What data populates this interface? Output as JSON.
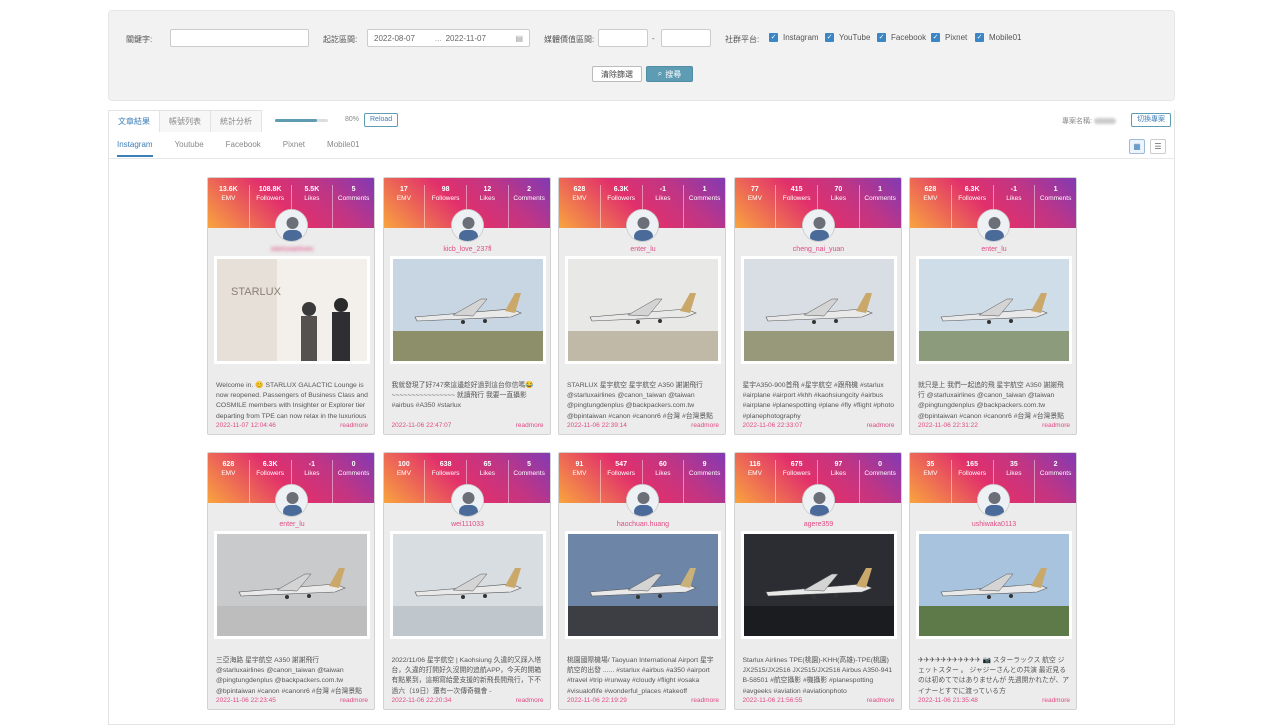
{
  "search": {
    "keyword_label": "關鍵字:",
    "date_label": "起訖區間:",
    "date_from": "2022-08-07",
    "date_sep": "...",
    "date_to": "2022-11-07",
    "value_label": "媒體價值區間:",
    "value_sep": "-",
    "platform_label": "社群平台:",
    "platforms": [
      "Instagram",
      "YouTube",
      "Facebook",
      "Pixnet",
      "Mobile01"
    ],
    "clear_label": "清除篩選",
    "search_label": "搜尋"
  },
  "tabs": [
    "文章結果",
    "帳號列表",
    "統計分析"
  ],
  "progress": {
    "value": 0.8,
    "label": "80%"
  },
  "reload_label": "Reload",
  "project_label": "專案名稱:",
  "switch_label": "切換專案",
  "subtabs": [
    "Instagram",
    "Youtube",
    "Facebook",
    "Pixnet",
    "Mobile01"
  ],
  "stat_labels": [
    "EMV",
    "Followers",
    "Likes",
    "Comments"
  ],
  "readmore": "readmore",
  "cards": [
    {
      "emv": "13.6K",
      "followers": "108.8K",
      "likes": "5.5K",
      "comments": "5",
      "user": "starluxairlines",
      "text": "Welcome in. 😊 STARLUX GALACTIC Lounge is now reopened. Passengers of Business Class and COSMILE members with Insighter or Explorer tier departing from TPE can now relax in the luxurious",
      "date": "2022-11-07 12:04:46"
    },
    {
      "emv": "17",
      "followers": "98",
      "likes": "12",
      "comments": "2",
      "user": "kicb_love_237fl",
      "text": "我就發現了好747來這邊趁好過到這台你信嗎😂 ~~~~~~~~~~~~~~~~ 就讀飛行 我要一直攝影 #airbus #A350 #starlux",
      "date": "2022-11-06 22:47:07"
    },
    {
      "emv": "628",
      "followers": "6.3K",
      "likes": "-1",
      "comments": "1",
      "user": "enter_lu",
      "text": "STARLUX 星宇航空 星宇航空 A350 謝謝飛行 @starluxairlines @canon_taiwan @taiwan @pingtungdenplus @backpackers.com.tw @bpintaiwan #canon #canonr6 #台灣 #台灣景點",
      "date": "2022-11-06 22:39:14"
    },
    {
      "emv": "77",
      "followers": "415",
      "likes": "70",
      "comments": "1",
      "user": "cheng_nai_yuan",
      "text": "星宇A350-900首飛 #星宇航空 #跟飛機 #starlux #airplane #airport #khh #kaohsiungcity #airbus #airplane #planespotting #plane #fly #flight #photo #planephotography",
      "date": "2022-11-06 22:33:07"
    },
    {
      "emv": "628",
      "followers": "6.3K",
      "likes": "-1",
      "comments": "1",
      "user": "enter_lu",
      "text": "就只是上 我們一起追的飛 星宇航空 A350 謝謝飛行 @starluxairlines @canon_taiwan @taiwan @pingtungdenplus @backpackers.com.tw @bpintaiwan #canon #canonr6 #台灣 #台灣景點",
      "date": "2022-11-06 22:31:22"
    },
    {
      "emv": "628",
      "followers": "6.3K",
      "likes": "-1",
      "comments": "0",
      "user": "enter_lu",
      "text": "三亞海路 星宇航空 A350 謝謝飛行 @starluxairlines @canon_taiwan @taiwan @pingtungdenplus @backpackers.com.tw @bpintaiwan #canon #canonr6 #台灣 #台灣景點",
      "date": "2022-11-06 22:23:45"
    },
    {
      "emv": "100",
      "followers": "638",
      "likes": "65",
      "comments": "5",
      "user": "wei111033",
      "text": "2022/11/06 星宇航空 | Kaohsiung 久違的又踩入塔台，久違的打開好久沒開的追航APP，今天的開箱有點累到，這期寫給愛支援的新飛長開飛行，下不過六（19日）還有一次傳奇機會 -",
      "date": "2022-11-06 22:20:34"
    },
    {
      "emv": "91",
      "followers": "547",
      "likes": "60",
      "comments": "9",
      "user": "haochuan.huang",
      "text": "桃園國際機場/ Taoyuan International Airport 星宇航空的出發 ...... #starlux #airbus #a350 #airport #travel #trip #runway #cloudy #flight #osaka #visualoflife #wonderful_places #takeoff",
      "date": "2022-11-06 22:19:29"
    },
    {
      "emv": "116",
      "followers": "675",
      "likes": "97",
      "comments": "0",
      "user": "agere359",
      "text": "Starlux Airlines TPE(桃園)-KHH(高雄)-TPE(桃園) JX2515/JX2516 JX2515/JX2516 Airbus A350-941 B-58501 #航空攝影 #機攝影 #planespotting #avgeeks #aviation #aviationphoto",
      "date": "2022-11-06 21:56:55"
    },
    {
      "emv": "35",
      "followers": "165",
      "likes": "35",
      "comments": "2",
      "user": "ushiwaka0113",
      "text": "✈✈✈✈✈✈✈✈✈✈✈ 📷 スターラックス 航空 ジェットスター 。 ジャジーさんとの共演 最近見るのは初めてではありませんが 先週開かれたが、アイナーとすでに渡っている方",
      "date": "2022-11-06 21:35:48"
    }
  ]
}
